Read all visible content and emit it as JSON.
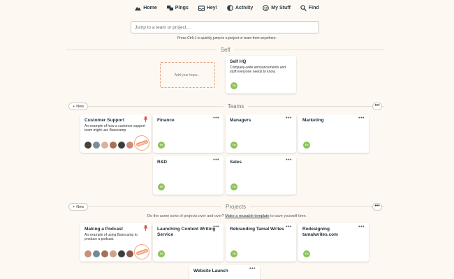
{
  "nav": {
    "items": [
      {
        "label": "Home",
        "icon": "mountain-icon"
      },
      {
        "label": "Pings",
        "icon": "chat-bubbles-icon"
      },
      {
        "label": "Hey!",
        "icon": "hey-inbox-icon"
      },
      {
        "label": "Activity",
        "icon": "half-circle-icon"
      },
      {
        "label": "My Stuff",
        "icon": "smiley-icon"
      },
      {
        "label": "Find",
        "icon": "magnifier-icon"
      }
    ]
  },
  "jump": {
    "placeholder": "Jump to a team or project…",
    "hint": "Press Ctrl+J to quickly jump to a project or team from anywhere."
  },
  "self": {
    "heading": "Self",
    "add_box_text": "Add your bops…",
    "hq": {
      "title": "Self HQ",
      "description": "Company-wide announcements and stuff everyone needs to know.",
      "avatar": "TG"
    }
  },
  "teams": {
    "heading": "Teams",
    "new_label": "New",
    "more_label": "•••",
    "cards": [
      {
        "title": "Customer Support",
        "description": "An example of how a customer support team might use Basecamp.",
        "sample": "SAMPLE"
      },
      {
        "title": "Finance",
        "avatar": "TG",
        "dots": "•••"
      },
      {
        "title": "Managers",
        "avatar": "TG",
        "dots": "•••"
      },
      {
        "title": "Marketing",
        "avatar": "TG",
        "dots": "•••"
      },
      {
        "title": "R&D",
        "avatar": "TG",
        "dots": "•••"
      },
      {
        "title": "Sales",
        "avatar": "TG",
        "dots": "•••"
      }
    ]
  },
  "projects": {
    "heading": "Projects",
    "new_label": "New",
    "more_label": "•••",
    "template_text_before": "Do the same sorts of projects over and over?",
    "template_link": "Make a reusable template",
    "template_text_after": "to save yourself time.",
    "cards": [
      {
        "title": "Making a Podcast",
        "description": "An example of using Basecamp to produce a podcast.",
        "sample": "SAMPLE"
      },
      {
        "title": "Launching Content Writing Service",
        "avatar": "TG",
        "dots": "•••"
      },
      {
        "title": "Rebranding Tamal Writes",
        "avatar": "TG",
        "dots": "•••"
      },
      {
        "title": "Redesigning tamalwrites.com",
        "avatar": "TG",
        "dots": "•••"
      },
      {
        "title": "Website Launch",
        "dots": "•••"
      }
    ]
  },
  "colors": {
    "background": "#fdf8f2",
    "avatar_green": "#8dc155",
    "accent_orange": "#f2926a",
    "pin_red": "#e8462d"
  }
}
